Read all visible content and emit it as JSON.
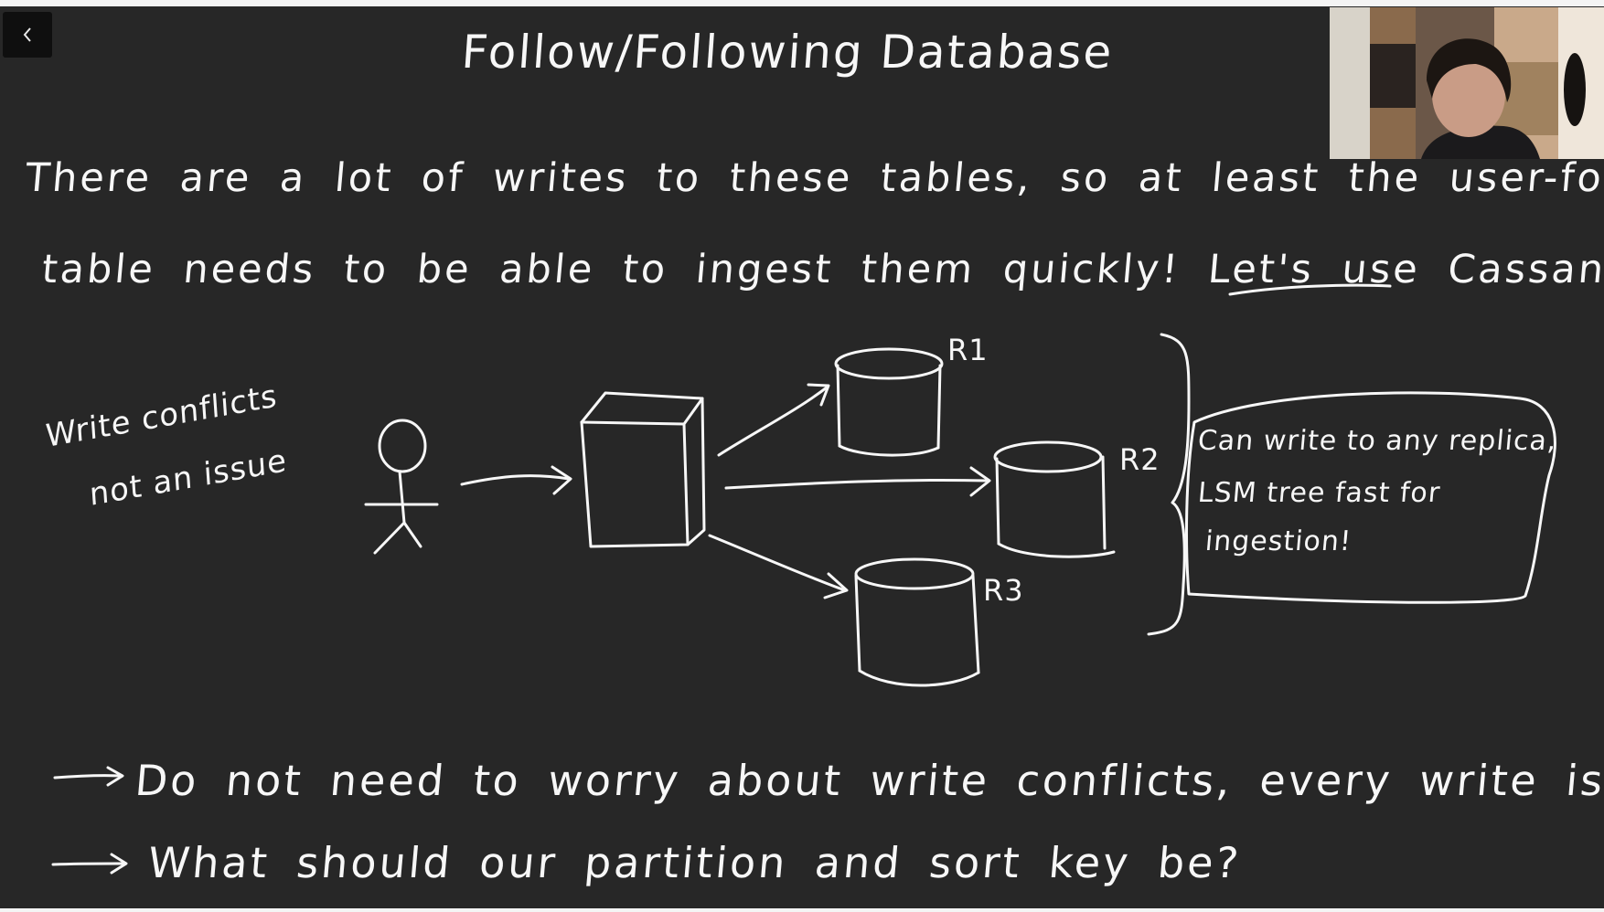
{
  "lecture": {
    "title": "Follow/Following Database",
    "intro_line_1": "There are a lot of writes to these tables, so at least the user-following",
    "intro_line_2_prefix": "table needs to be able to ingest them quickly! Let's use",
    "intro_line_2_highlight": "Cassandra",
    "intro_line_2_suffix": "!"
  },
  "diagram": {
    "side_note_line_1": "Write conflicts",
    "side_note_line_2": "not an issue",
    "replicas": [
      "R1",
      "R2",
      "R3"
    ],
    "callout_lines": [
      "Can write to any replica,",
      "LSM tree fast for",
      "ingestion!"
    ]
  },
  "bullets": [
    "Do not need to worry about write conflicts, every write is valid!",
    "What should our partition and sort key be?"
  ],
  "controls": {
    "back_icon": "chevron-left-icon"
  },
  "colors": {
    "board_background": "#272727",
    "ink": "#f7f7f7"
  }
}
